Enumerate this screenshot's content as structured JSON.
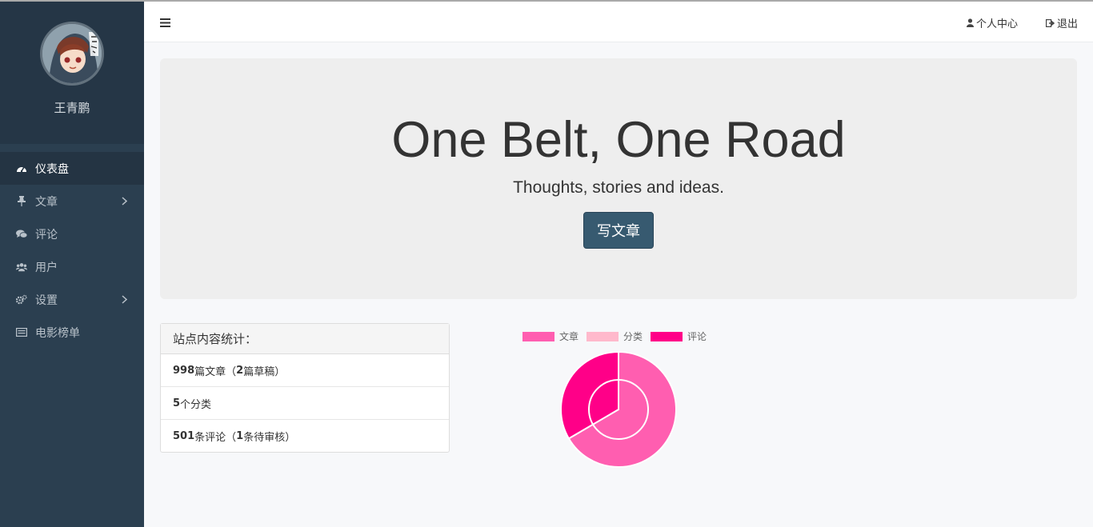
{
  "sidebar": {
    "username": "王青鹏",
    "items": [
      {
        "label": "仪表盘",
        "icon": "dashboard-icon",
        "active": true,
        "has_submenu": false
      },
      {
        "label": "文章",
        "icon": "pin-icon",
        "active": false,
        "has_submenu": true
      },
      {
        "label": "评论",
        "icon": "comments-icon",
        "active": false,
        "has_submenu": false
      },
      {
        "label": "用户",
        "icon": "users-icon",
        "active": false,
        "has_submenu": false
      },
      {
        "label": "设置",
        "icon": "cogs-icon",
        "active": false,
        "has_submenu": true
      },
      {
        "label": "电影榜单",
        "icon": "list-icon",
        "active": false,
        "has_submenu": false
      }
    ]
  },
  "topbar": {
    "menu_icon": "hamburger-icon",
    "profile_label": "个人中心",
    "logout_label": "退出"
  },
  "jumbotron": {
    "title": "One Belt, One Road",
    "subtitle": "Thoughts, stories and ideas.",
    "button_label": "写文章"
  },
  "stats": {
    "heading": "站点内容统计：",
    "rows": [
      {
        "count": "998",
        "text": "篇文章（",
        "sub_count": "2",
        "sub_text": "篇草稿）"
      },
      {
        "count": "5",
        "text": "个分类",
        "sub_count": "",
        "sub_text": ""
      },
      {
        "count": "501",
        "text": "条评论（",
        "sub_count": "1",
        "sub_text": "条待审核）"
      }
    ]
  },
  "colors": {
    "sidebar_bg": "#2b3f50",
    "primary_button": "#375a70",
    "article": "#ff5eb0",
    "category": "#ffb9cc",
    "comment": "#ff0088"
  },
  "chart_data": {
    "type": "pie",
    "legend": [
      "文章",
      "分类",
      "评论"
    ],
    "outer": {
      "labels": [
        "文章",
        "评论"
      ],
      "values": [
        998,
        501
      ]
    },
    "inner": {
      "labels": [
        "分类"
      ],
      "values": [
        5
      ]
    }
  }
}
